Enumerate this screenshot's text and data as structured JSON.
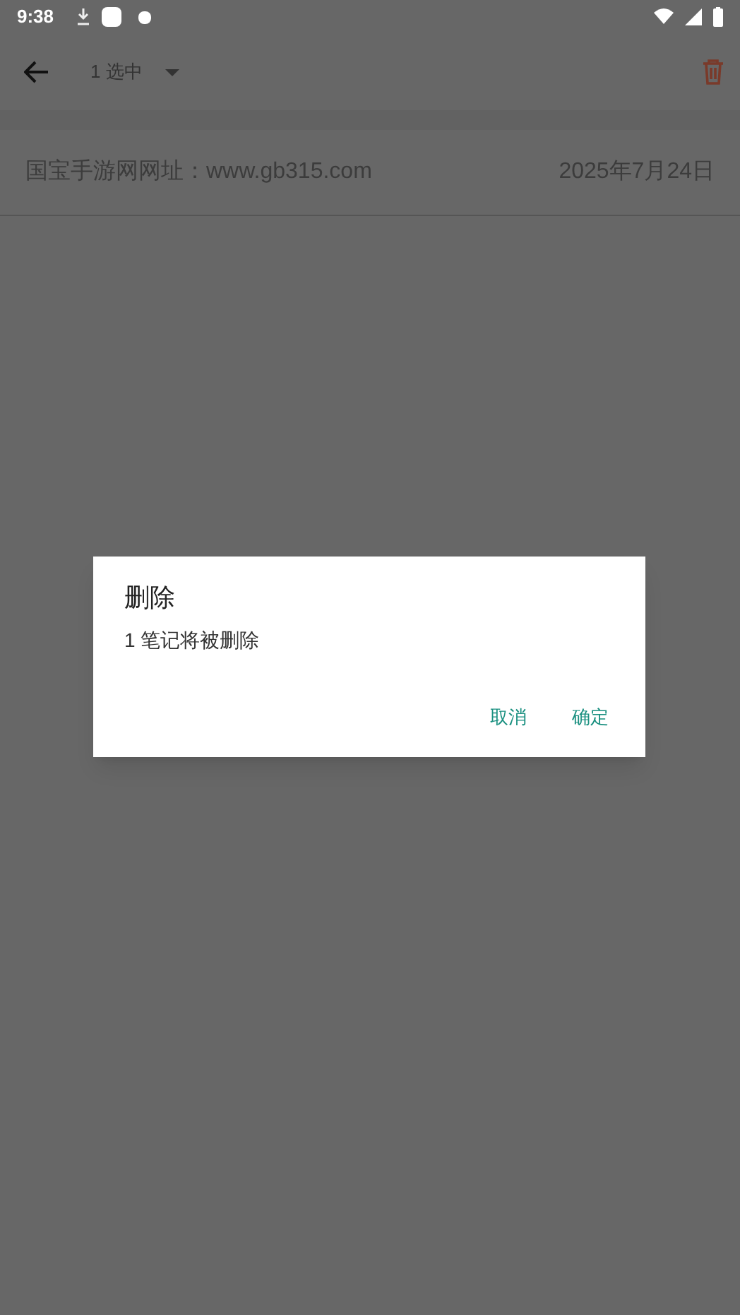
{
  "status_bar": {
    "time": "9:38"
  },
  "toolbar": {
    "selection": "1 选中"
  },
  "notes": [
    {
      "title": "国宝手游网网址：www.gb315.com",
      "date": "2025年7月24日"
    }
  ],
  "dialog": {
    "title": "删除",
    "message": "1 笔记将被删除",
    "buttons": [
      "取消",
      "确定"
    ]
  }
}
